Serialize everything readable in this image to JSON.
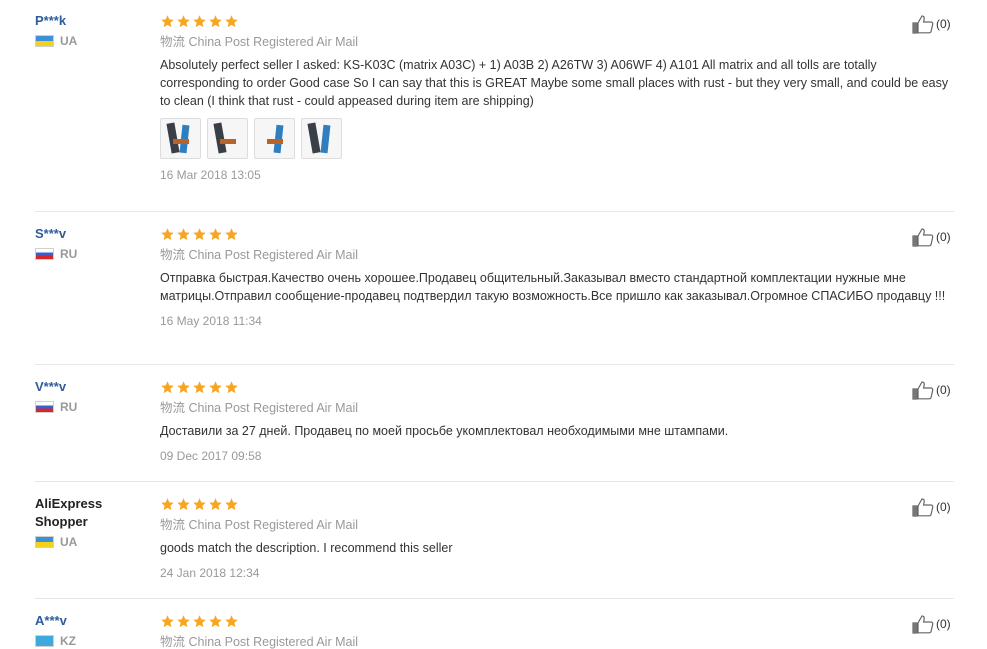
{
  "star_color": "#f5a623",
  "reviews": [
    {
      "user": "P***k",
      "country": "UA",
      "flag": "ua",
      "rating": 5,
      "shipping": "物流 China Post Registered Air Mail",
      "text": "Absolutely perfect seller I asked: KS-K03C (matrix A03C) + 1) A03B 2) A26TW 3) A06WF 4) A101 All matrix and all tolls are totally corresponding to order Good case So I can say that this is GREAT Maybe some small places with rust - but they very small, and could be easy to clean (I think that rust - could appeased during item are shipping)",
      "images": 4,
      "date": "16 Mar 2018 13:05",
      "likes": "(0)"
    },
    {
      "user": "S***v",
      "country": "RU",
      "flag": "ru",
      "rating": 5,
      "shipping": "物流 China Post Registered Air Mail",
      "text": "Отправка быстрая.Качество очень хорошее.Продавец общительный.Заказывал вместо стандартной комплектации нужные мне матрицы.Отправил сообщение-продавец подтвердил такую возможность.Все пришло как заказывал.Огромное СПАСИБО продавцу !!!",
      "date": "16 May 2018 11:34",
      "likes": "(0)"
    },
    {
      "user": "V***v",
      "country": "RU",
      "flag": "ru",
      "rating": 5,
      "shipping": "物流 China Post Registered Air Mail",
      "text": "Доставили за 27 дней. Продавец по моей просьбе укомплектовал необходимыми мне штампами.",
      "date": "09 Dec 2017 09:58",
      "likes": "(0)"
    },
    {
      "user": "AliExpress Shopper",
      "country": "UA",
      "flag": "ua",
      "rating": 5,
      "shipping": "物流 China Post Registered Air Mail",
      "text": "goods match the description. I recommend this seller",
      "date": "24 Jan 2018 12:34",
      "likes": "(0)"
    },
    {
      "user": "A***v",
      "country": "KZ",
      "flag": "kz",
      "rating": 5,
      "shipping": "物流 China Post Registered Air Mail",
      "text": "",
      "date": "",
      "likes": "(0)"
    }
  ]
}
